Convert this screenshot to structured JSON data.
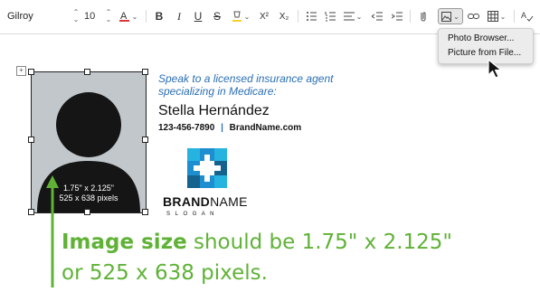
{
  "toolbar": {
    "font_family": "Gilroy",
    "font_size": "10",
    "format_buttons": [
      "B",
      "I",
      "U",
      "S",
      "X²",
      "X₂"
    ],
    "icons": [
      "font-color-icon",
      "highlight-icon",
      "bullet-list-icon",
      "numbered-list-icon",
      "align-icon",
      "outdent-icon",
      "indent-icon",
      "attach-icon",
      "insert-image-icon",
      "link-icon",
      "table-icon",
      "spellcheck-icon"
    ]
  },
  "image_menu": {
    "items": [
      "Photo Browser...",
      "Picture from File..."
    ]
  },
  "signature": {
    "tagline_line1": "Speak to a licensed insurance agent",
    "tagline_line2": "specializing in Medicare:",
    "name": "Stella Hernández",
    "phone": "123-456-7890",
    "separator": "|",
    "website": "BrandName.com",
    "brand_bold": "BRAND",
    "brand_light": "NAME",
    "slogan": "S L O G A N",
    "tagline_color": "#2a6fb4",
    "logo_colors": [
      "#1d8fd1",
      "#27b3e0",
      "#16628f"
    ]
  },
  "photo": {
    "caption_line1": "1.75\" x 2.125\"",
    "caption_line2": "525 x 638 pixels",
    "background": "#c2c7cc",
    "silhouette": "#151515"
  },
  "note": {
    "bold": "Image size",
    "rest": " should be 1.75\" x 2.125\"",
    "line2": "or 525 x 638 pixels.",
    "color": "#5fb236"
  }
}
